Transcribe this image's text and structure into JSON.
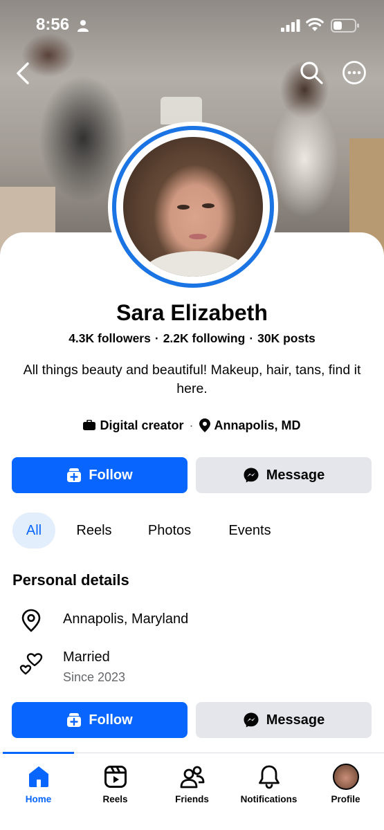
{
  "status_bar": {
    "time": "8:56"
  },
  "profile": {
    "name": "Sara Elizabeth",
    "followers": "4.3K followers",
    "following": "2.2K following",
    "posts": "30K posts",
    "bio": "All things beauty and beautiful! Makeup, hair, tans, find it here.",
    "category": "Digital creator",
    "location": "Annapolis, MD"
  },
  "actions": {
    "follow_label": "Follow",
    "message_label": "Message"
  },
  "tabs": [
    {
      "label": "All",
      "active": true
    },
    {
      "label": "Reels",
      "active": false
    },
    {
      "label": "Photos",
      "active": false
    },
    {
      "label": "Events",
      "active": false
    }
  ],
  "personal_details": {
    "title": "Personal details",
    "location": "Annapolis, Maryland",
    "relationship": "Married",
    "relationship_since": "Since 2023"
  },
  "bottom_nav": [
    {
      "label": "Home",
      "icon": "home-icon",
      "active": true
    },
    {
      "label": "Reels",
      "icon": "reels-icon",
      "active": false
    },
    {
      "label": "Friends",
      "icon": "friends-icon",
      "active": false
    },
    {
      "label": "Notifications",
      "icon": "bell-icon",
      "active": false
    },
    {
      "label": "Profile",
      "icon": "profile-avatar",
      "active": false
    }
  ],
  "colors": {
    "accent": "#0866ff",
    "secondary_button": "#e4e6eb",
    "active_tab_bg": "#e3eefd",
    "avatar_ring": "#1b74e4"
  }
}
